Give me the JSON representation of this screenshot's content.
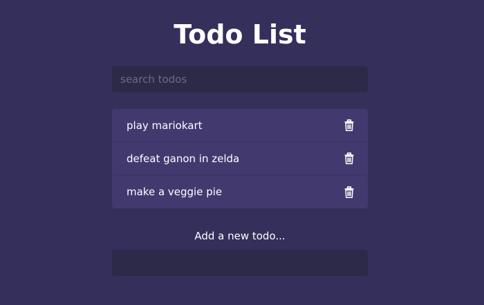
{
  "app": {
    "title": "Todo List"
  },
  "search": {
    "placeholder": "search todos",
    "value": ""
  },
  "todos": [
    {
      "text": "play mariokart",
      "icon": "trash-icon"
    },
    {
      "text": "defeat ganon in zelda",
      "icon": "trash-icon"
    },
    {
      "text": "make a veggie pie",
      "icon": "trash-icon"
    }
  ],
  "add": {
    "label": "Add a new todo...",
    "value": ""
  },
  "colors": {
    "background": "#352f5b",
    "input_background": "#2d2948",
    "item_background": "#423a6f",
    "text": "#ffffff",
    "placeholder": "#6e6a86"
  }
}
